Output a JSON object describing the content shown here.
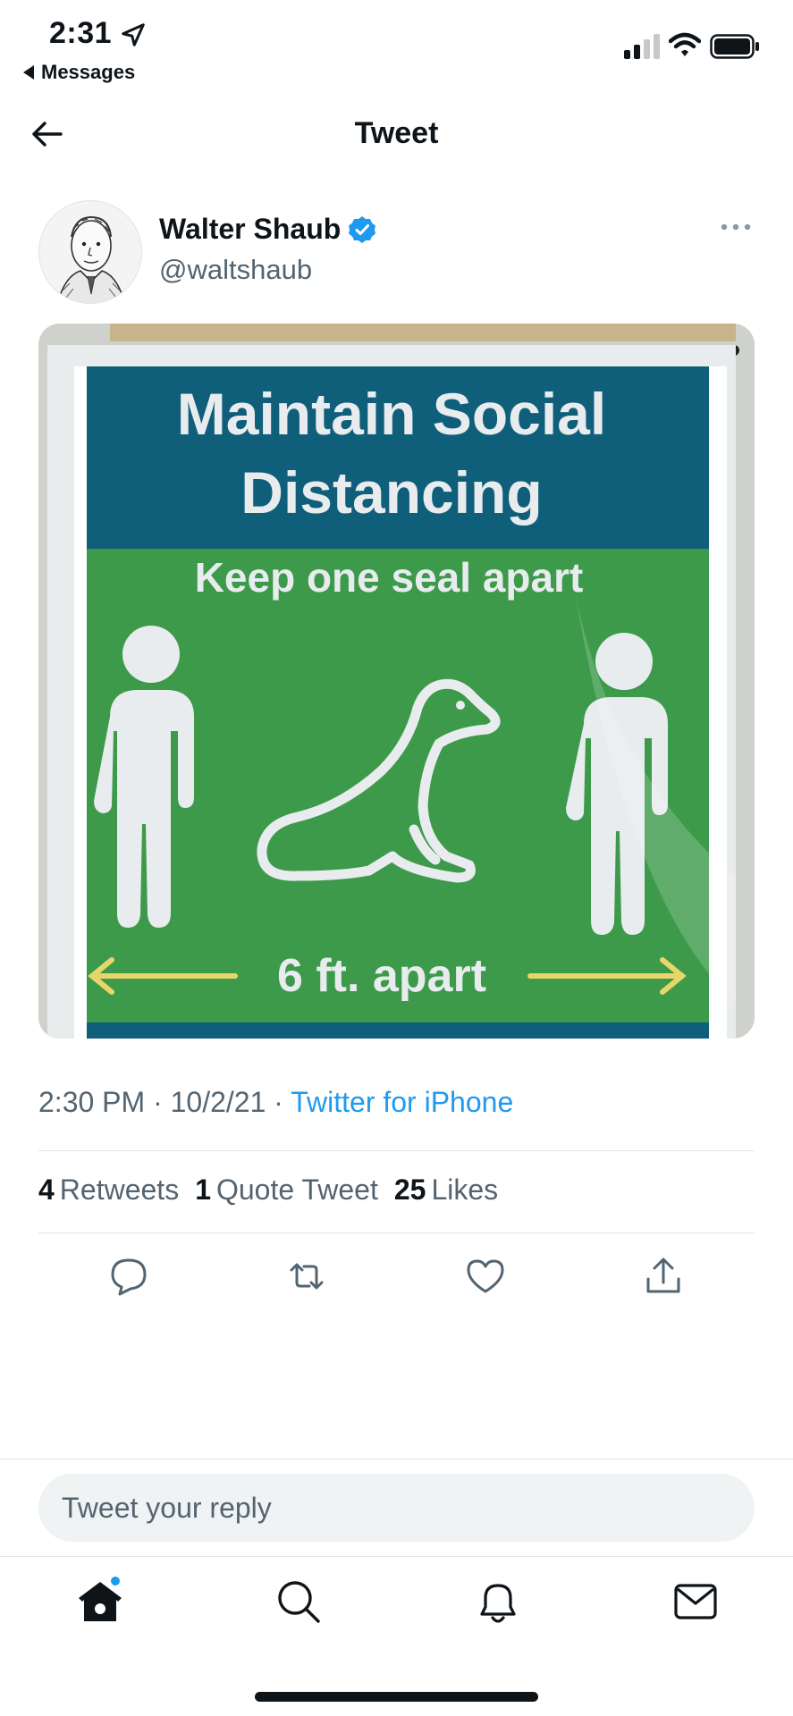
{
  "status_bar": {
    "time": "2:31",
    "back_app": "Messages"
  },
  "header": {
    "title": "Tweet"
  },
  "author": {
    "display_name": "Walter Shaub",
    "handle": "@waltshaub"
  },
  "media": {
    "sign_title_line1": "Maintain Social",
    "sign_title_line2": "Distancing",
    "sign_subtitle": "Keep one seal apart",
    "sign_footer": "6 ft. apart"
  },
  "meta": {
    "time": "2:30 PM",
    "date": "10/2/21",
    "separator": "·",
    "source": "Twitter for iPhone"
  },
  "stats": {
    "retweets_count": "4",
    "retweets_label": "Retweets",
    "quotes_count": "1",
    "quotes_label": "Quote Tweet",
    "likes_count": "25",
    "likes_label": "Likes"
  },
  "reply": {
    "placeholder": "Tweet your reply"
  },
  "colors": {
    "accent": "#1d9bf0",
    "sign_blue": "#0f5f7a",
    "sign_green": "#3d9a4a"
  },
  "icons": {
    "actions": [
      "reply-icon",
      "retweet-icon",
      "like-icon",
      "share-icon"
    ],
    "tabs": [
      "home-icon",
      "search-icon",
      "notifications-icon",
      "messages-icon"
    ]
  }
}
